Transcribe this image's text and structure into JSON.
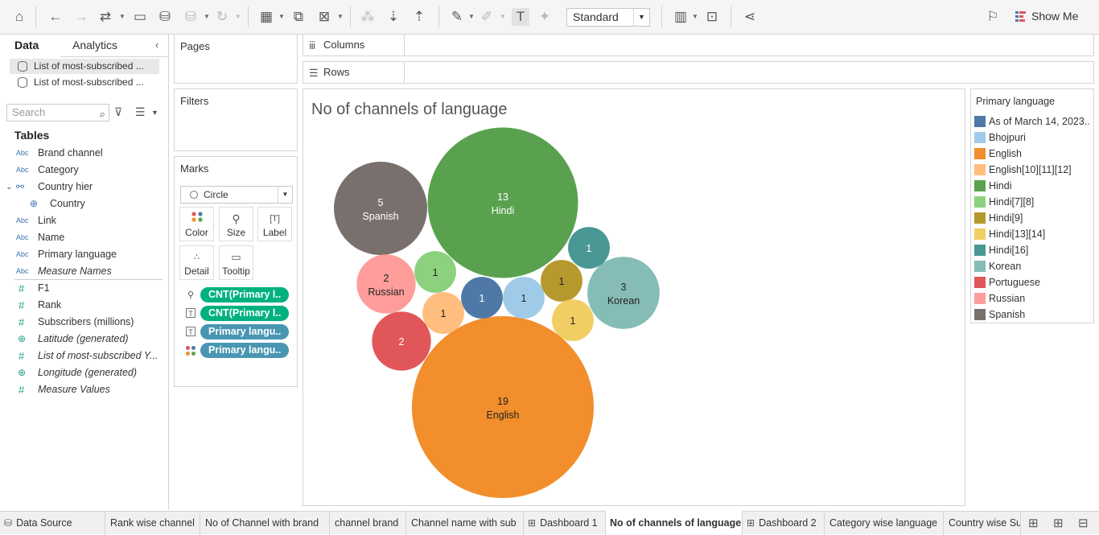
{
  "toolbar": {
    "fit_value": "Standard",
    "show_me_label": "Show Me"
  },
  "data_pane": {
    "tabs": {
      "data": "Data",
      "analytics": "Analytics"
    },
    "datasources": [
      "List of most-subscribed ...",
      "List of most-subscribed ..."
    ],
    "search_placeholder": "Search",
    "tables_heading": "Tables",
    "fields": [
      {
        "type": "abc",
        "label": "Brand channel"
      },
      {
        "type": "abc",
        "label": "Category"
      },
      {
        "type": "hier",
        "label": "Country hier"
      },
      {
        "type": "geo-child",
        "label": "Country"
      },
      {
        "type": "abc",
        "label": "Link"
      },
      {
        "type": "abc",
        "label": "Name"
      },
      {
        "type": "abc",
        "label": "Primary language"
      },
      {
        "type": "abc-italic",
        "label": "Measure Names"
      },
      {
        "type": "num",
        "label": "F1"
      },
      {
        "type": "num",
        "label": "Rank"
      },
      {
        "type": "num",
        "label": "Subscribers (millions)"
      },
      {
        "type": "geo-italic",
        "label": "Latitude (generated)"
      },
      {
        "type": "num-italic",
        "label": "List of most-subscribed Y..."
      },
      {
        "type": "geo-italic",
        "label": "Longitude (generated)"
      },
      {
        "type": "num-italic",
        "label": "Measure Values"
      }
    ]
  },
  "shelves": {
    "pages": "Pages",
    "filters": "Filters",
    "columns": "Columns",
    "rows": "Rows"
  },
  "marks": {
    "title": "Marks",
    "type": "Circle",
    "buttons": {
      "color": "Color",
      "size": "Size",
      "label": "Label",
      "detail": "Detail",
      "tooltip": "Tooltip"
    },
    "pills": [
      "CNT(Primary l..",
      "CNT(Primary l..",
      "Primary langu..",
      "Primary langu.."
    ]
  },
  "viz": {
    "title": "No of channels of language"
  },
  "legend": {
    "title": "Primary language",
    "items": [
      {
        "label": "As of March 14, 2023..",
        "color": "#4e79a7"
      },
      {
        "label": "Bhojpuri",
        "color": "#a0cbe8"
      },
      {
        "label": "English",
        "color": "#f28e2b"
      },
      {
        "label": "English[10][11][12]",
        "color": "#ffbe7d"
      },
      {
        "label": "Hindi",
        "color": "#59a14f"
      },
      {
        "label": "Hindi[7][8]",
        "color": "#8cd17d"
      },
      {
        "label": "Hindi[9]",
        "color": "#b6992d"
      },
      {
        "label": "Hindi[13][14]",
        "color": "#f1ce63"
      },
      {
        "label": "Hindi[16]",
        "color": "#499894"
      },
      {
        "label": "Korean",
        "color": "#86bcb6"
      },
      {
        "label": "Portuguese",
        "color": "#e15759"
      },
      {
        "label": "Russian",
        "color": "#ff9d9a"
      },
      {
        "label": "Spanish",
        "color": "#79706e"
      }
    ]
  },
  "chart_data": {
    "type": "bubble",
    "title": "No of channels of language",
    "bubbles": [
      {
        "language": "English",
        "count": 19,
        "color": "#f28e2b",
        "show_name": true
      },
      {
        "language": "Hindi",
        "count": 13,
        "color": "#59a14f",
        "show_name": true
      },
      {
        "language": "Spanish",
        "count": 5,
        "color": "#79706e",
        "show_name": true
      },
      {
        "language": "Korean",
        "count": 3,
        "color": "#86bcb6",
        "show_name": true
      },
      {
        "language": "Russian",
        "count": 2,
        "color": "#ff9d9a",
        "show_name": true
      },
      {
        "language": "Portuguese",
        "count": 2,
        "color": "#e15759",
        "show_name": false
      },
      {
        "language": "As of March 14, 2023..",
        "count": 1,
        "color": "#4e79a7",
        "show_name": false
      },
      {
        "language": "Bhojpuri",
        "count": 1,
        "color": "#a0cbe8",
        "show_name": false
      },
      {
        "language": "English[10][11][12]",
        "count": 1,
        "color": "#ffbe7d",
        "show_name": false
      },
      {
        "language": "Hindi[7][8]",
        "count": 1,
        "color": "#8cd17d",
        "show_name": false
      },
      {
        "language": "Hindi[9]",
        "count": 1,
        "color": "#b6992d",
        "show_name": false
      },
      {
        "language": "Hindi[13][14]",
        "count": 1,
        "color": "#f1ce63",
        "show_name": false
      },
      {
        "language": "Hindi[16]",
        "count": 1,
        "color": "#499894",
        "show_name": false
      }
    ]
  },
  "sheet_tabs": [
    {
      "label": "Data Source",
      "icon": "datasource"
    },
    {
      "label": "Rank wise channel",
      "icon": ""
    },
    {
      "label": "No of Channel with brand",
      "icon": ""
    },
    {
      "label": "channel brand",
      "icon": ""
    },
    {
      "label": "Channel name with sub",
      "icon": ""
    },
    {
      "label": "Dashboard 1",
      "icon": "dashboard"
    },
    {
      "label": "No of channels of language",
      "icon": "",
      "active": true
    },
    {
      "label": "Dashboard 2",
      "icon": "dashboard"
    },
    {
      "label": "Category wise language",
      "icon": ""
    },
    {
      "label": "Country wise Su",
      "icon": ""
    }
  ]
}
